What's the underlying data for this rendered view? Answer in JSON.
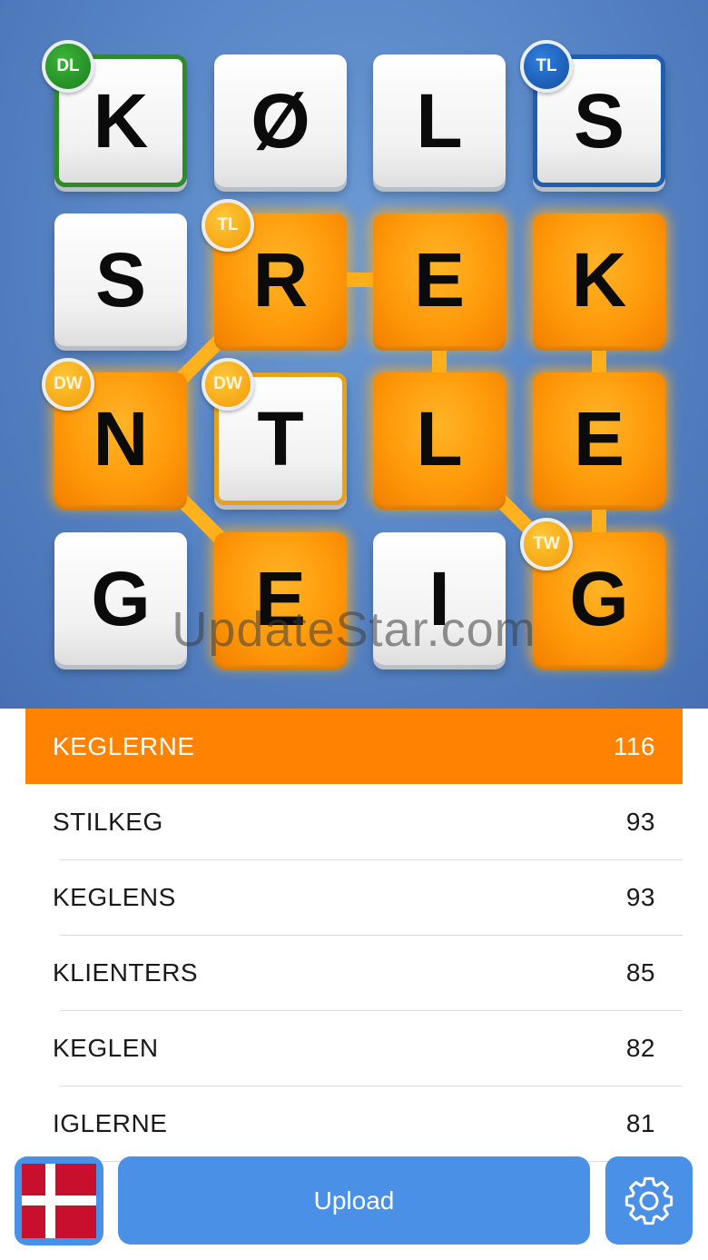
{
  "board": {
    "tiles": [
      {
        "letter": "K",
        "selected": false,
        "bonus": "DL"
      },
      {
        "letter": "Ø",
        "selected": false,
        "bonus": ""
      },
      {
        "letter": "L",
        "selected": false,
        "bonus": ""
      },
      {
        "letter": "S",
        "selected": false,
        "bonus": "TL"
      },
      {
        "letter": "S",
        "selected": false,
        "bonus": ""
      },
      {
        "letter": "R",
        "selected": true,
        "bonus": "TL"
      },
      {
        "letter": "E",
        "selected": true,
        "bonus": ""
      },
      {
        "letter": "K",
        "selected": true,
        "bonus": ""
      },
      {
        "letter": "N",
        "selected": true,
        "bonus": "DW"
      },
      {
        "letter": "T",
        "selected": false,
        "bonus": "DW"
      },
      {
        "letter": "L",
        "selected": true,
        "bonus": ""
      },
      {
        "letter": "E",
        "selected": true,
        "bonus": ""
      },
      {
        "letter": "G",
        "selected": false,
        "bonus": ""
      },
      {
        "letter": "E",
        "selected": true,
        "bonus": ""
      },
      {
        "letter": "I",
        "selected": false,
        "bonus": ""
      },
      {
        "letter": "G",
        "selected": true,
        "bonus": "TW"
      }
    ],
    "path": [
      7,
      11,
      15,
      10,
      6,
      5,
      8,
      13
    ]
  },
  "watermark": "UpdateStar.com",
  "words": [
    {
      "word": "KEGLERNE",
      "score": "116",
      "active": true
    },
    {
      "word": "STILKEG",
      "score": "93",
      "active": false
    },
    {
      "word": "KEGLENS",
      "score": "93",
      "active": false
    },
    {
      "word": "KLIENTERS",
      "score": "85",
      "active": false
    },
    {
      "word": "KEGLEN",
      "score": "82",
      "active": false
    },
    {
      "word": "IGLERNE",
      "score": "81",
      "active": false
    }
  ],
  "bottom_bar": {
    "upload_label": "Upload",
    "flag_icon": "denmark-flag-icon",
    "settings_icon": "gear-icon"
  },
  "colors": {
    "board_blue": "#5683c4",
    "selected_orange": "#ff9a0a",
    "active_row": "#ff8200",
    "button_blue": "#4a90e6",
    "dl_green": "#2f8a2a",
    "tl_blue": "#1d5fae",
    "dw_tw_orange": "#f29a05",
    "flag_red": "#c8102e"
  }
}
